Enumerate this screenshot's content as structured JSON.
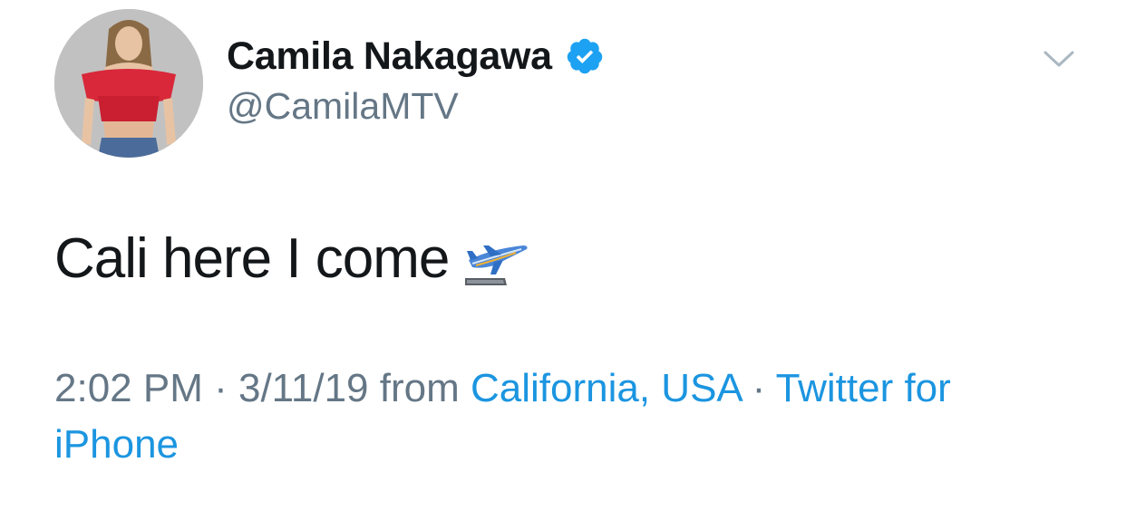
{
  "user": {
    "display_name": "Camila Nakagawa",
    "handle": "@CamilaMTV",
    "verified": true
  },
  "tweet": {
    "text": "Cali here I come",
    "emoji": "airplane-departure"
  },
  "meta": {
    "time": "2:02 PM",
    "sep1": " · ",
    "date": "3/11/19",
    "from": " from ",
    "location": "California, USA",
    "sep2": " · ",
    "source": "Twitter for iPhone"
  },
  "colors": {
    "text": "#14171a",
    "secondary": "#657786",
    "link": "#1b95e0",
    "verified": "#1da1f2"
  },
  "icons": {
    "verified": "verified-badge-icon",
    "menu": "chevron-down-icon",
    "emoji": "airplane-departure-icon"
  }
}
